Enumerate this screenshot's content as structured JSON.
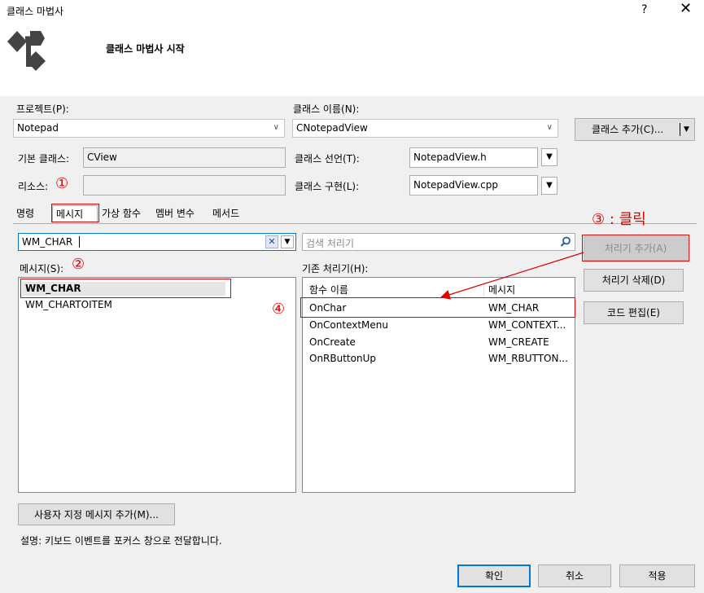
{
  "window": {
    "title": "클래스 마법사",
    "help": "?",
    "close": "✕",
    "subtitle": "클래스 마법사 시작"
  },
  "project": {
    "label": "프로젝트(P):",
    "value": "Notepad"
  },
  "class_name": {
    "label": "클래스 이름(N):",
    "value": "CNotepadView"
  },
  "add_class": {
    "label": "클래스 추가(C)..."
  },
  "base_class": {
    "label": "기본 클래스:",
    "value": "CView"
  },
  "class_decl": {
    "label": "클래스 선언(T):",
    "value": "NotepadView.h"
  },
  "resource": {
    "label": "리소스:",
    "value": ""
  },
  "class_impl": {
    "label": "클래스 구현(L):",
    "value": "NotepadView.cpp"
  },
  "tabs": [
    "명령",
    "메시지",
    "가상 함수",
    "멤버 변수",
    "메서드"
  ],
  "filter": {
    "value": "WM_CHAR"
  },
  "handler_search": {
    "placeholder": "검색 처리기"
  },
  "messages": {
    "label": "메시지(S):",
    "items": [
      "WM_CHAR",
      "WM_CHARTOITEM"
    ]
  },
  "handlers": {
    "label": "기존 처리기(H):",
    "col_name": "함수 이름",
    "col_msg": "메시지",
    "rows": [
      {
        "name": "OnChar",
        "msg": "WM_CHAR"
      },
      {
        "name": "OnContextMenu",
        "msg": "WM_CONTEXT..."
      },
      {
        "name": "OnCreate",
        "msg": "WM_CREATE"
      },
      {
        "name": "OnRButtonUp",
        "msg": "WM_RBUTTON..."
      }
    ]
  },
  "buttons": {
    "add_handler": "처리기 추가(A)",
    "delete_handler": "처리기 삭제(D)",
    "edit_code": "코드 편집(E)",
    "custom_message": "사용자 지정 메시지 추가(M)...",
    "ok": "확인",
    "cancel": "취소",
    "apply": "적용"
  },
  "description": "설명:  키보드 이벤트를 포커스 창으로 전달합니다.",
  "annotations": {
    "n1": "①",
    "n2": "②",
    "n3": "③ : 클릭",
    "n4": "④"
  },
  "colors": {
    "annotation": "#e00000",
    "accent": "#0078d7"
  }
}
